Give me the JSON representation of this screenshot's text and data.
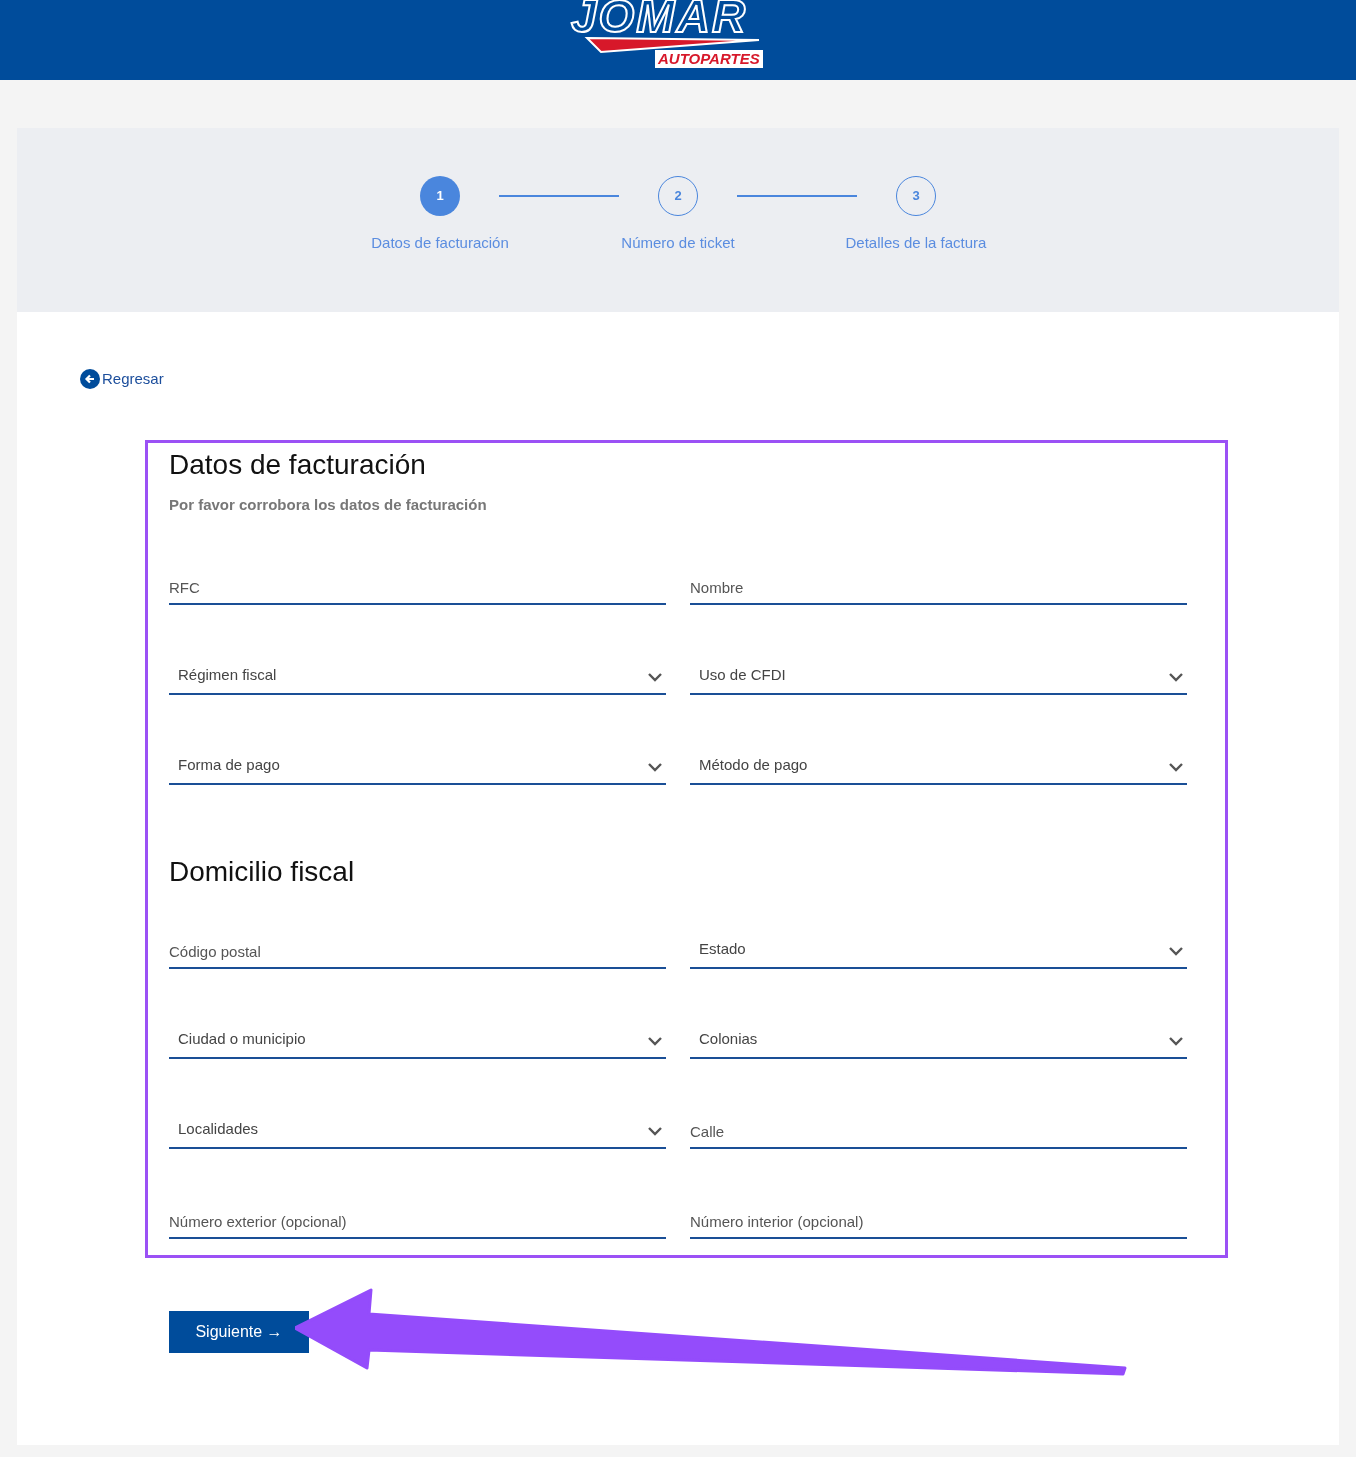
{
  "header": {
    "logo_main": "JOMAR",
    "logo_sub": "AUTOPARTES"
  },
  "steps": [
    {
      "number": "1",
      "label": "Datos de facturación",
      "selected": true
    },
    {
      "number": "2",
      "label": "Número de ticket",
      "selected": false
    },
    {
      "number": "3",
      "label": "Detalles de la factura",
      "selected": false
    }
  ],
  "back_link": "Regresar",
  "billing": {
    "title": "Datos de facturación",
    "subtitle": "Por favor corrobora los datos de facturación",
    "fields": [
      {
        "kind": "input",
        "placeholder": "RFC"
      },
      {
        "kind": "input",
        "placeholder": "Nombre"
      },
      {
        "kind": "select",
        "placeholder": "Régimen fiscal"
      },
      {
        "kind": "select",
        "placeholder": "Uso de CFDI"
      },
      {
        "kind": "select",
        "placeholder": "Forma de pago"
      },
      {
        "kind": "select",
        "placeholder": "Método de pago"
      }
    ]
  },
  "address": {
    "title": "Domicilio fiscal",
    "fields": [
      {
        "kind": "input",
        "placeholder": "Código postal"
      },
      {
        "kind": "select",
        "placeholder": "Estado"
      },
      {
        "kind": "select",
        "placeholder": "Ciudad o municipio"
      },
      {
        "kind": "select",
        "placeholder": "Colonias"
      },
      {
        "kind": "select",
        "placeholder": "Localidades"
      },
      {
        "kind": "input",
        "placeholder": "Calle"
      },
      {
        "kind": "input",
        "placeholder": "Número exterior (opcional)"
      },
      {
        "kind": "input",
        "placeholder": "Número interior (opcional)"
      }
    ]
  },
  "next_button": {
    "label": "Siguiente",
    "arrow": "→"
  }
}
